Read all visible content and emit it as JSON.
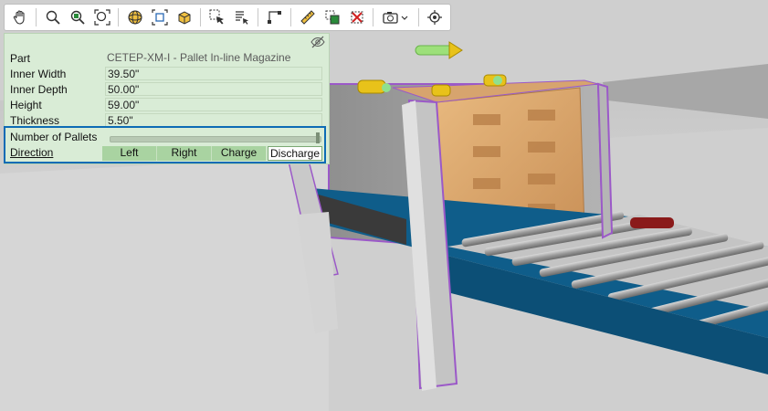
{
  "toolbar": {
    "icons": [
      "pan-icon",
      "zoom-icon",
      "zoom-window-icon",
      "zoom-extents-icon",
      "orbit-icon",
      "fit-view-icon",
      "view-cube-icon",
      "select-icon",
      "select-list-icon",
      "snap-icon",
      "measure-icon",
      "copy-icon",
      "delete-icon",
      "camera-icon",
      "center-view-icon"
    ]
  },
  "panel": {
    "rows": [
      {
        "label": "Part",
        "value": "CETEP-XM-I - Pallet In-line Magazine"
      },
      {
        "label": "Inner Width",
        "value": "39.50\""
      },
      {
        "label": "Inner Depth",
        "value": "50.00\""
      },
      {
        "label": "Height",
        "value": "59.00\""
      },
      {
        "label": "Thickness",
        "value": "5.50\""
      }
    ],
    "pallets_label": "Number of Pallets",
    "direction_label": "Direction",
    "direction_options": [
      "Left",
      "Right",
      "Charge",
      "Discharge"
    ],
    "direction_selected": "Discharge"
  },
  "colors": {
    "panel_bg": "#d9ecd6",
    "highlight_border": "#0d6bb5",
    "selection_outline": "#9b59c8",
    "conveyor_blue": "#0f5d8a",
    "pallet_wood": "#dba46c"
  }
}
